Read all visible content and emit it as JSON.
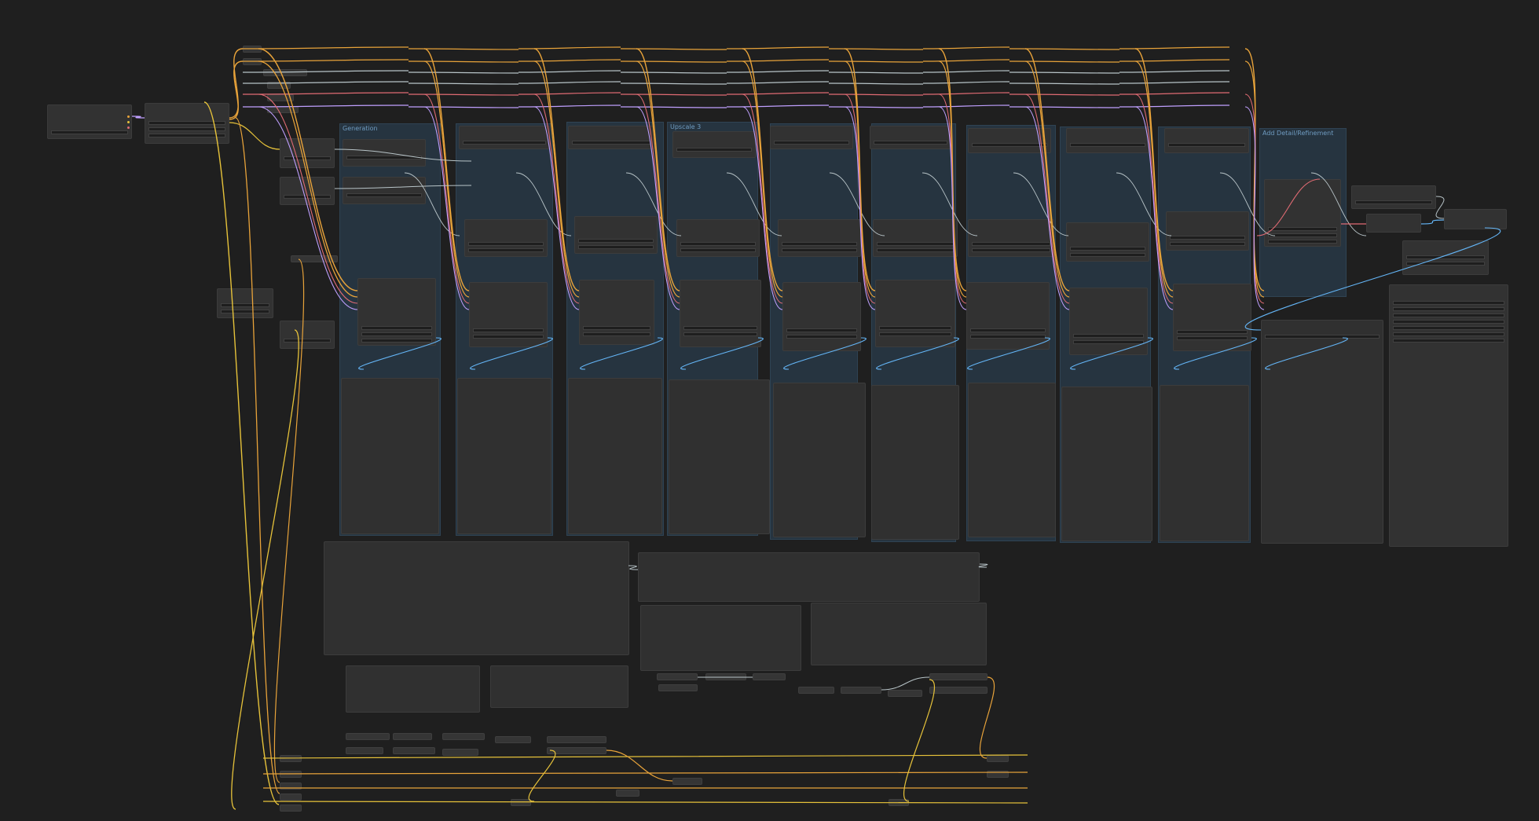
{
  "app": {
    "title": ""
  },
  "groups": [
    {
      "id": "g1",
      "title": "Generation"
    },
    {
      "id": "g2",
      "title": ""
    },
    {
      "id": "g3",
      "title": ""
    },
    {
      "id": "g4",
      "title": "Upscale 3"
    },
    {
      "id": "g5",
      "title": ""
    },
    {
      "id": "g6",
      "title": ""
    },
    {
      "id": "g7",
      "title": ""
    },
    {
      "id": "g8",
      "title": ""
    },
    {
      "id": "g9",
      "title": ""
    },
    {
      "id": "g10",
      "title": "Add Detail/Refinement"
    }
  ],
  "colors": {
    "background": "#1f1f1f",
    "group_fill": "#263440",
    "node_fill": "#323232",
    "wire_model": "#e8a33a",
    "wire_clip": "#e6c23a",
    "wire_vae": "#e06b73",
    "wire_conditioning": "#c0a0ff",
    "wire_latent": "#d0b2ff",
    "wire_image": "#64b5f6",
    "wire_generic": "#b8c4c8"
  },
  "icons": {
    "node_collapse": "dot-icon",
    "input_slot": "slot-dot-icon",
    "output_slot": "slot-dot-icon"
  }
}
